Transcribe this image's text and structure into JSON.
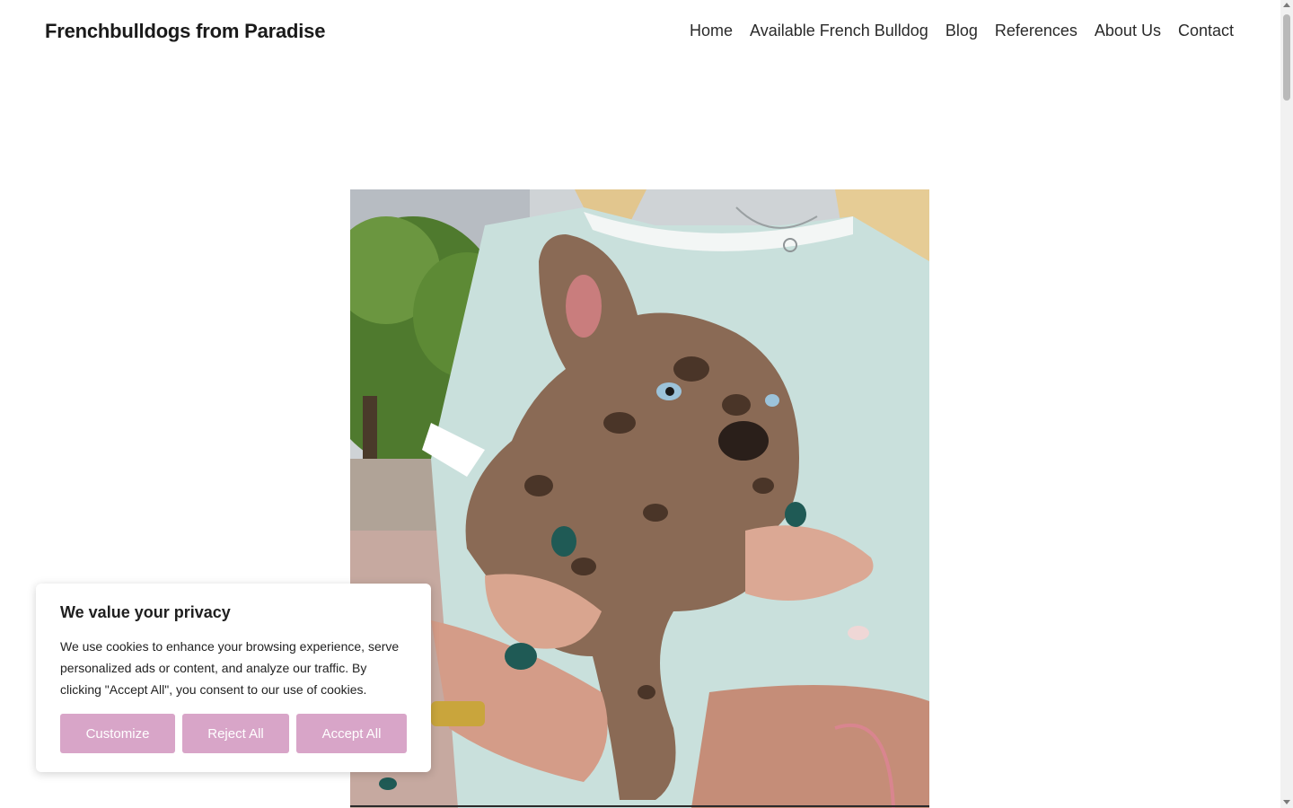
{
  "header": {
    "site_title": "Frenchbulldogs from Paradise",
    "nav": [
      {
        "label": "Home"
      },
      {
        "label": "Available French Bulldog"
      },
      {
        "label": "Blog"
      },
      {
        "label": "References"
      },
      {
        "label": "About Us"
      },
      {
        "label": "Contact"
      }
    ]
  },
  "hero": {
    "image": "french-bulldog-puppy-photo"
  },
  "cookie_banner": {
    "title": "We value your privacy",
    "message": "We use cookies to enhance your browsing experience, serve personalized ads or content, and analyze our traffic. By clicking \"Accept All\", you consent to our use of cookies.",
    "customize_label": "Customize",
    "reject_label": "Reject All",
    "accept_label": "Accept All",
    "button_color": "#d8a5c8"
  }
}
